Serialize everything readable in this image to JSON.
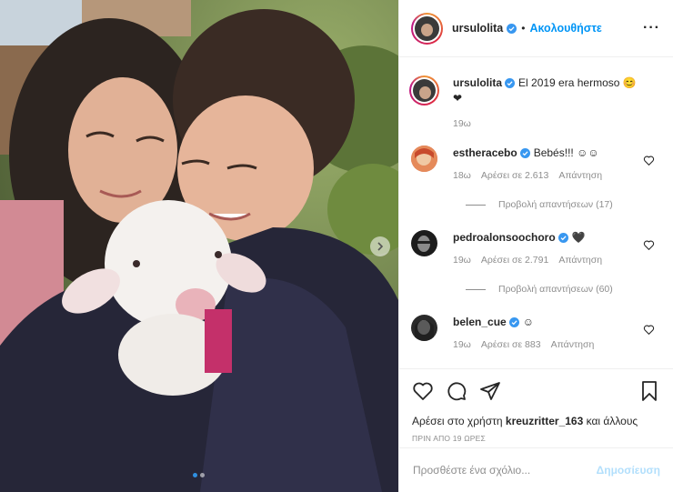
{
  "post": {
    "username": "ursulolita",
    "follow_label": "Ακολουθήστε",
    "caption": "El 2019 era hermoso 😊❤",
    "caption_time": "19ω"
  },
  "comments": [
    {
      "username": "estheracebo",
      "text": "Bebés!!! ☺☺",
      "verified": true,
      "time": "18ω",
      "likes": "Αρέσει σε 2.613",
      "reply": "Απάντηση",
      "view_replies": "Προβολή απαντήσεων (17)"
    },
    {
      "username": "pedroalonsoochoro",
      "text": "🖤",
      "verified": true,
      "time": "19ω",
      "likes": "Αρέσει σε 2.791",
      "reply": "Απάντηση",
      "view_replies": "Προβολή απαντήσεων (60)"
    },
    {
      "username": "belen_cue",
      "text": "☺",
      "verified": true,
      "time": "19ω",
      "likes": "Αρέσει σε 883",
      "reply": "Απάντηση"
    }
  ],
  "likes_line": {
    "prefix": "Αρέσει στο χρήστη",
    "user": "kreuzritter_163",
    "suffix": "και άλλους"
  },
  "time_ago": "ΠΡΙΝ ΑΠΟ 19 ΩΡΕΣ",
  "add_comment": {
    "placeholder": "Προσθέστε ένα σχόλιο...",
    "publish_label": "Δημοσίευση"
  },
  "colors": {
    "accent": "#0095f6",
    "verified": "#3897f0",
    "publish_disabled": "#b2dffc",
    "muted": "#8e8e8e"
  },
  "carousel": {
    "slides": 2,
    "active": 1
  }
}
